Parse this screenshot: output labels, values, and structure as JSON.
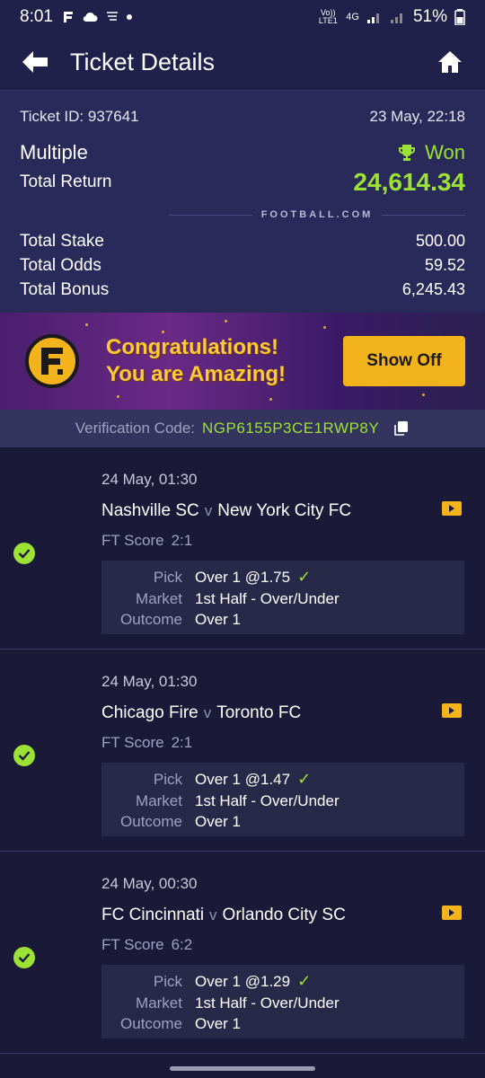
{
  "status": {
    "time": "8:01",
    "network_label": "Vo)) LTE1",
    "network_type": "4G",
    "battery": "51%"
  },
  "header": {
    "title": "Ticket Details"
  },
  "ticket": {
    "id_label": "Ticket ID: 937641",
    "datetime": "23 May, 22:18",
    "type": "Multiple",
    "status": "Won",
    "total_return_label": "Total Return",
    "total_return": "24,614.34",
    "brand": "FOOTBALL.COM",
    "stats": [
      {
        "label": "Total Stake",
        "value": "500.00"
      },
      {
        "label": "Total Odds",
        "value": "59.52"
      },
      {
        "label": "Total Bonus",
        "value": "6,245.43"
      }
    ]
  },
  "banner": {
    "line1": "Congratulations!",
    "line2": "You are Amazing!",
    "button": "Show Off"
  },
  "verification": {
    "label": "Verification Code:",
    "code": "NGP6155P3CE1RWP8Y"
  },
  "labels": {
    "ft_score": "FT Score",
    "pick": "Pick",
    "market": "Market",
    "outcome": "Outcome",
    "versus": "v"
  },
  "bets": [
    {
      "time": "24 May, 01:30",
      "home": "Nashville SC",
      "away": "New York City FC",
      "score": "2:1",
      "pick": "Over 1 @1.75",
      "market": "1st Half - Over/Under",
      "outcome": "Over 1"
    },
    {
      "time": "24 May, 01:30",
      "home": "Chicago Fire",
      "away": "Toronto FC",
      "score": "2:1",
      "pick": "Over 1 @1.47",
      "market": "1st Half - Over/Under",
      "outcome": "Over 1"
    },
    {
      "time": "24 May, 00:30",
      "home": "FC Cincinnati",
      "away": "Orlando City SC",
      "score": "6:2",
      "pick": "Over 1 @1.29",
      "market": "1st Half - Over/Under",
      "outcome": "Over 1"
    }
  ],
  "colors": {
    "accent_green": "#9be234",
    "accent_yellow": "#f3b41b",
    "header_bg": "#20204a",
    "summary_bg": "#2a2a5a",
    "page_bg": "#1a1a38"
  }
}
